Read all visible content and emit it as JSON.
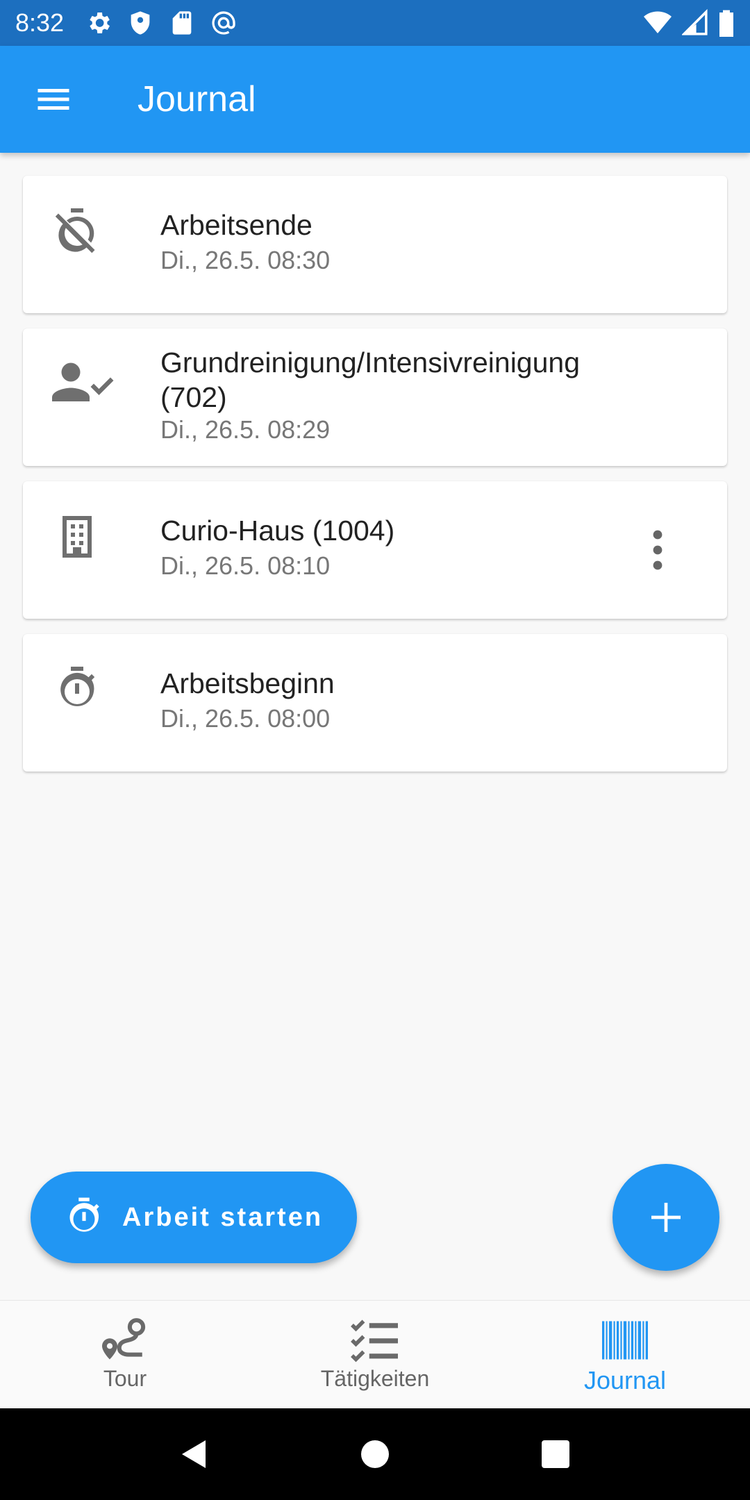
{
  "status_bar": {
    "time": "8:32"
  },
  "app_bar": {
    "title": "Journal"
  },
  "entries": [
    {
      "icon": "timer-off-icon",
      "title": "Arbeitsende",
      "subtitle": "Di., 26.5. 08:30"
    },
    {
      "icon": "person-check-icon",
      "title": "Grundreinigung/Intensivreinigung (702)",
      "subtitle": "Di., 26.5. 08:29"
    },
    {
      "icon": "building-icon",
      "title": "Curio-Haus (1004)",
      "subtitle": "Di., 26.5. 08:10",
      "has_menu": true
    },
    {
      "icon": "timer-icon",
      "title": "Arbeitsbeginn",
      "subtitle": "Di., 26.5. 08:00"
    }
  ],
  "fab_extended": {
    "label": "Arbeit starten",
    "icon": "timer-icon"
  },
  "fab_add": {
    "icon": "plus-icon"
  },
  "bottom_nav": {
    "items": [
      {
        "label": "Tour",
        "icon": "route-icon",
        "active": false
      },
      {
        "label": "Tätigkeiten",
        "icon": "checklist-icon",
        "active": false
      },
      {
        "label": "Journal",
        "icon": "barcode-icon",
        "active": true
      }
    ]
  },
  "colors": {
    "primary": "#2196f3",
    "status_bar": "#1c6fbf",
    "icon_gray": "#6f6f6f"
  }
}
